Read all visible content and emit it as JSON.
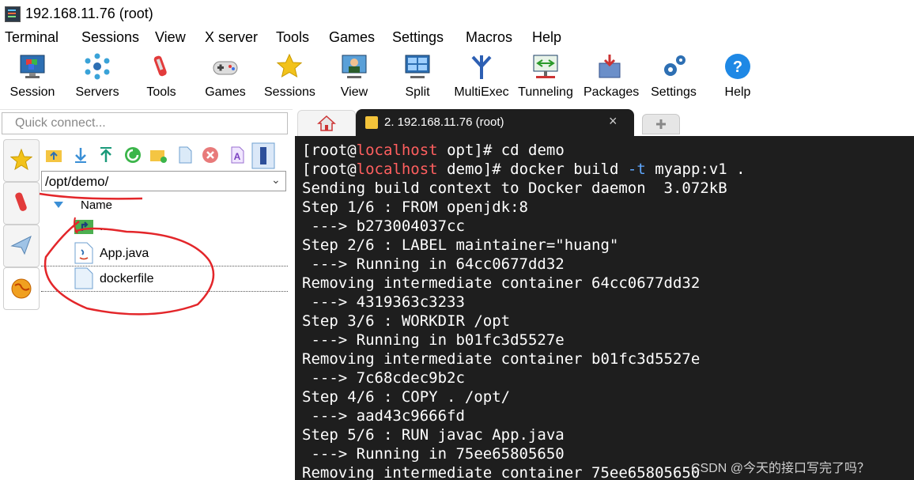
{
  "window": {
    "title": "192.168.11.76 (root)"
  },
  "menu": [
    "Terminal",
    "Sessions",
    "View",
    "X server",
    "Tools",
    "Games",
    "Settings",
    "Macros",
    "Help"
  ],
  "toolbar": [
    "Session",
    "Servers",
    "Tools",
    "Games",
    "Sessions",
    "View",
    "Split",
    "MultiExec",
    "Tunneling",
    "Packages",
    "Settings",
    "Help"
  ],
  "quick_connect": {
    "placeholder": "Quick connect..."
  },
  "tabs": {
    "active_label": "2. 192.168.11.76 (root)",
    "close": "×"
  },
  "sftp": {
    "path": "/opt/demo/",
    "column_header": "Name",
    "parent": "..",
    "files": [
      "App.java",
      "dockerfile"
    ]
  },
  "terminal": {
    "lines": [
      {
        "user": "root",
        "host": "localhost",
        "dir": "opt",
        "cmd": "cd demo"
      },
      {
        "user": "root",
        "host": "localhost",
        "dir": "demo",
        "cmd_pre": "docker build ",
        "flag": "-t",
        "cmd_post": " myapp:v1 ."
      },
      "Sending build context to Docker daemon  3.072kB",
      "Step 1/6 : FROM openjdk:8",
      " ---> b273004037cc",
      "Step 2/6 : LABEL maintainer=\"huang\"",
      " ---> Running in 64cc0677dd32",
      "Removing intermediate container 64cc0677dd32",
      " ---> 4319363c3233",
      "Step 3/6 : WORKDIR /opt",
      " ---> Running in b01fc3d5527e",
      "Removing intermediate container b01fc3d5527e",
      " ---> 7c68cdec9b2c",
      "Step 4/6 : COPY . /opt/",
      " ---> aad43c9666fd",
      "Step 5/6 : RUN javac App.java",
      " ---> Running in 75ee65805650",
      "Removing intermediate container 75ee65805650"
    ]
  },
  "watermark": "CSDN @今天的接口写完了吗？"
}
